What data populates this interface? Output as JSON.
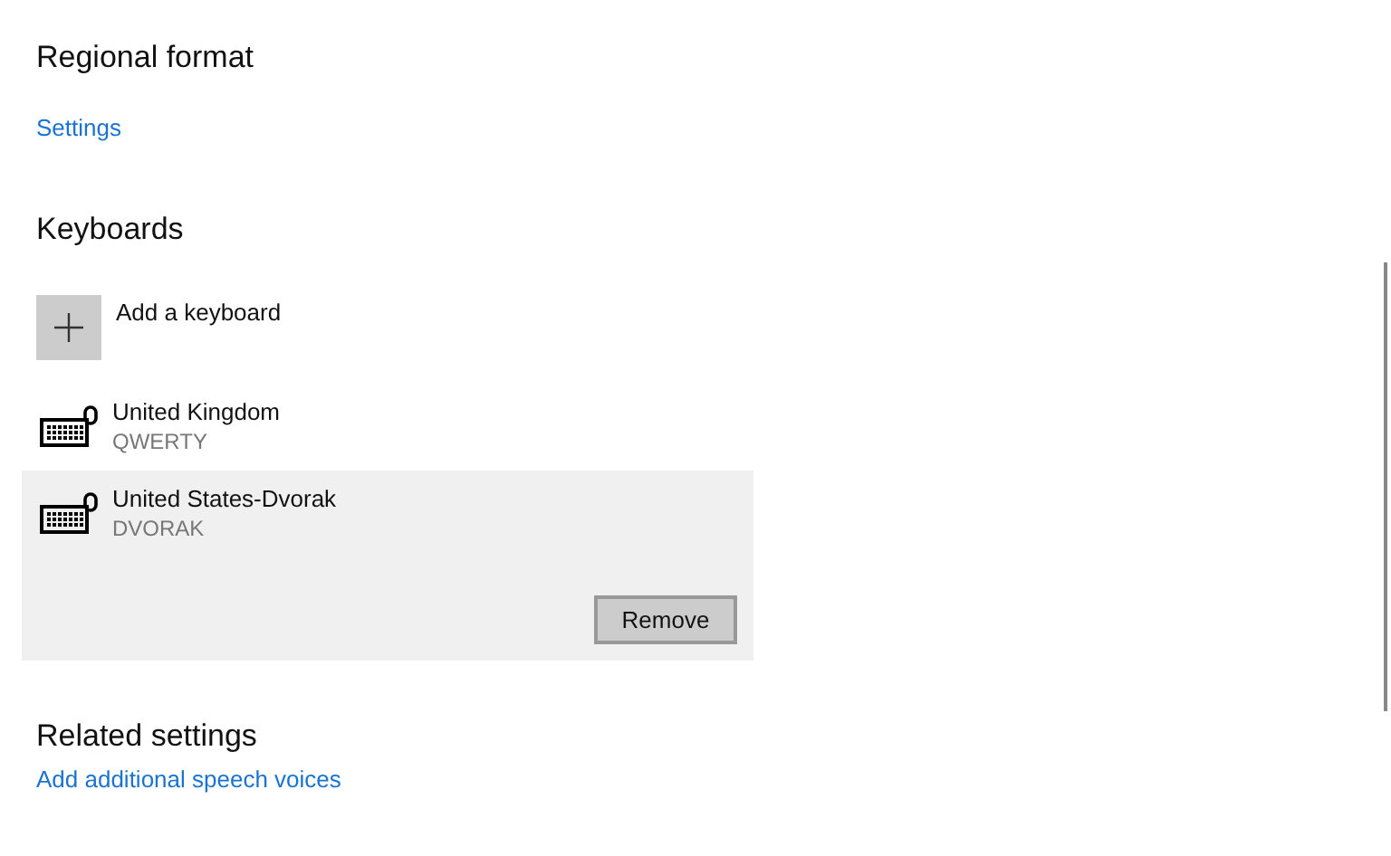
{
  "regional_format": {
    "heading": "Regional format",
    "link": "Settings"
  },
  "keyboards": {
    "heading": "Keyboards",
    "add_label": "Add a keyboard",
    "items": [
      {
        "name": "United Kingdom",
        "layout": "QWERTY",
        "selected": false
      },
      {
        "name": "United States-Dvorak",
        "layout": "DVORAK",
        "selected": true
      }
    ],
    "remove_button": "Remove"
  },
  "related_settings": {
    "heading": "Related settings",
    "link": "Add additional speech voices"
  }
}
